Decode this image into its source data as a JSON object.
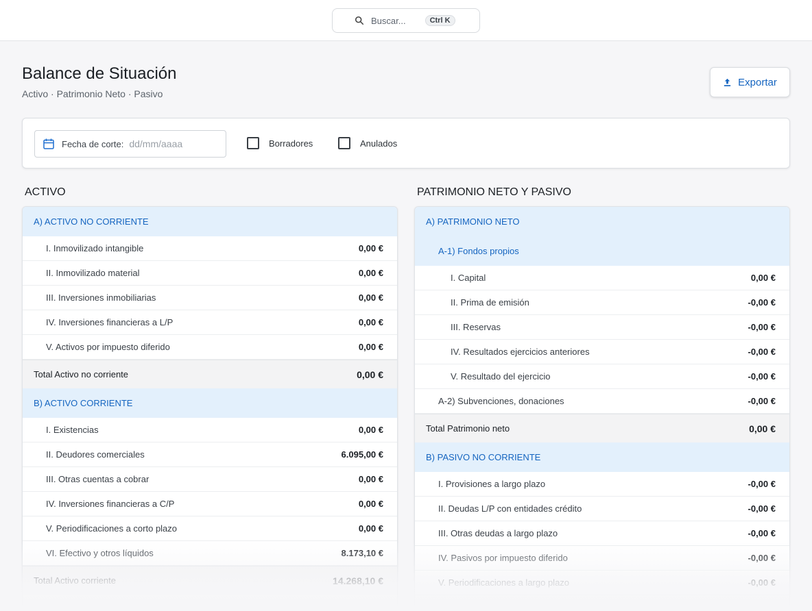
{
  "search": {
    "placeholder": "Buscar...",
    "shortcut": "Ctrl K"
  },
  "header": {
    "title": "Balance de Situación",
    "subtitle": "Activo · Patrimonio Neto · Pasivo",
    "export_label": "Exportar"
  },
  "filters": {
    "date_label": "Fecha de corte:",
    "date_placeholder": "dd/mm/aaaa",
    "draft_label": "Borradores",
    "voided_label": "Anulados"
  },
  "activo": {
    "heading": "ACTIVO",
    "no_corriente": {
      "title": "A) ACTIVO NO CORRIENTE",
      "items": [
        {
          "label": "I. Inmovilizado intangible",
          "value": "0,00 €"
        },
        {
          "label": "II. Inmovilizado material",
          "value": "0,00 €"
        },
        {
          "label": "III. Inversiones inmobiliarias",
          "value": "0,00 €"
        },
        {
          "label": "IV. Inversiones financieras a L/P",
          "value": "0,00 €"
        },
        {
          "label": "V. Activos por impuesto diferido",
          "value": "0,00 €"
        }
      ],
      "total_label": "Total Activo no corriente",
      "total_value": "0,00 €"
    },
    "corriente": {
      "title": "B) ACTIVO CORRIENTE",
      "items": [
        {
          "label": "I. Existencias",
          "value": "0,00 €"
        },
        {
          "label": "II. Deudores comerciales",
          "value": "6.095,00 €"
        },
        {
          "label": "III. Otras cuentas a cobrar",
          "value": "0,00 €"
        },
        {
          "label": "IV. Inversiones financieras a C/P",
          "value": "0,00 €"
        },
        {
          "label": "V. Periodificaciones a corto plazo",
          "value": "0,00 €"
        },
        {
          "label": "VI. Efectivo y otros líquidos",
          "value": "8.173,10 €"
        }
      ],
      "total_label": "Total Activo corriente",
      "total_value": "14.268,10 €"
    }
  },
  "pasivo": {
    "heading": "PATRIMONIO NETO Y PASIVO",
    "patrimonio": {
      "title": "A) PATRIMONIO NETO",
      "fondos_title": "A-1) Fondos propios",
      "fondos_items": [
        {
          "label": "I. Capital",
          "value": "0,00 €"
        },
        {
          "label": "II. Prima de emisión",
          "value": "-0,00 €"
        },
        {
          "label": "III. Reservas",
          "value": "-0,00 €"
        },
        {
          "label": "IV. Resultados ejercicios anteriores",
          "value": "-0,00 €"
        },
        {
          "label": "V. Resultado del ejercicio",
          "value": "-0,00 €"
        }
      ],
      "subvenciones": {
        "label": "A-2) Subvenciones, donaciones",
        "value": "-0,00 €"
      },
      "total_label": "Total Patrimonio neto",
      "total_value": "0,00 €"
    },
    "no_corriente": {
      "title": "B) PASIVO NO CORRIENTE",
      "items": [
        {
          "label": "I. Provisiones a largo plazo",
          "value": "-0,00 €"
        },
        {
          "label": "II. Deudas L/P con entidades crédito",
          "value": "-0,00 €"
        },
        {
          "label": "III. Otras deudas a largo plazo",
          "value": "-0,00 €"
        },
        {
          "label": "IV. Pasivos por impuesto diferido",
          "value": "-0,00 €"
        },
        {
          "label": "V. Periodificaciones a largo plazo",
          "value": "-0,00 €"
        }
      ]
    }
  }
}
